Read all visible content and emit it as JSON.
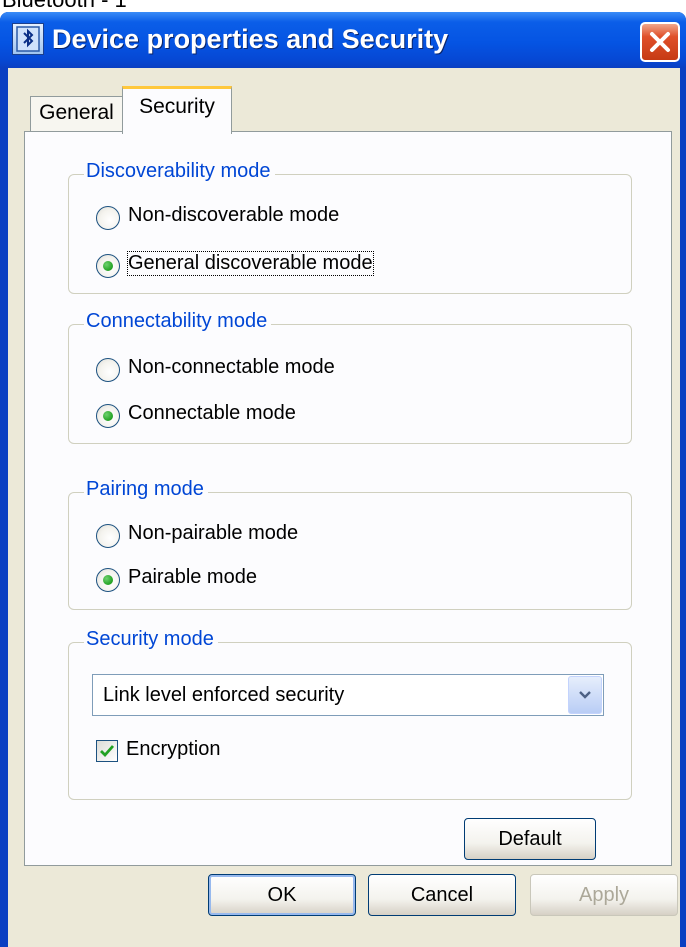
{
  "top_text": "Bluetooth - 1",
  "window": {
    "title": "Device properties and Security"
  },
  "tabs": [
    {
      "label": "General",
      "selected": false
    },
    {
      "label": "Security",
      "selected": true
    }
  ],
  "groups": {
    "discoverability": {
      "title": "Discoverability mode",
      "options": [
        {
          "label": "Non-discoverable mode",
          "selected": false
        },
        {
          "label": "General discoverable mode",
          "selected": true
        }
      ]
    },
    "connectability": {
      "title": "Connectability mode",
      "options": [
        {
          "label": "Non-connectable mode",
          "selected": false
        },
        {
          "label": "Connectable mode",
          "selected": true
        }
      ]
    },
    "pairing": {
      "title": "Pairing mode",
      "options": [
        {
          "label": "Non-pairable mode",
          "selected": false
        },
        {
          "label": "Pairable mode",
          "selected": true
        }
      ]
    },
    "security": {
      "title": "Security mode",
      "select_value": "Link level enforced security",
      "encryption_label": "Encryption",
      "encryption_checked": true
    }
  },
  "buttons": {
    "default": "Default",
    "ok": "OK",
    "cancel": "Cancel",
    "apply": "Apply",
    "apply_enabled": false
  },
  "colors": {
    "title_bar": "#0554e3",
    "dialog_bg": "#ece9d8",
    "group_title": "#0046d5",
    "radio_selected": "#21a121",
    "active_tab_highlight": "#ffc83c",
    "close_button": "#e0502a"
  },
  "icons": {
    "app": "bluetooth-device-icon",
    "close": "close-icon",
    "dropdown": "chevron-down-icon",
    "check": "checkmark-icon"
  }
}
